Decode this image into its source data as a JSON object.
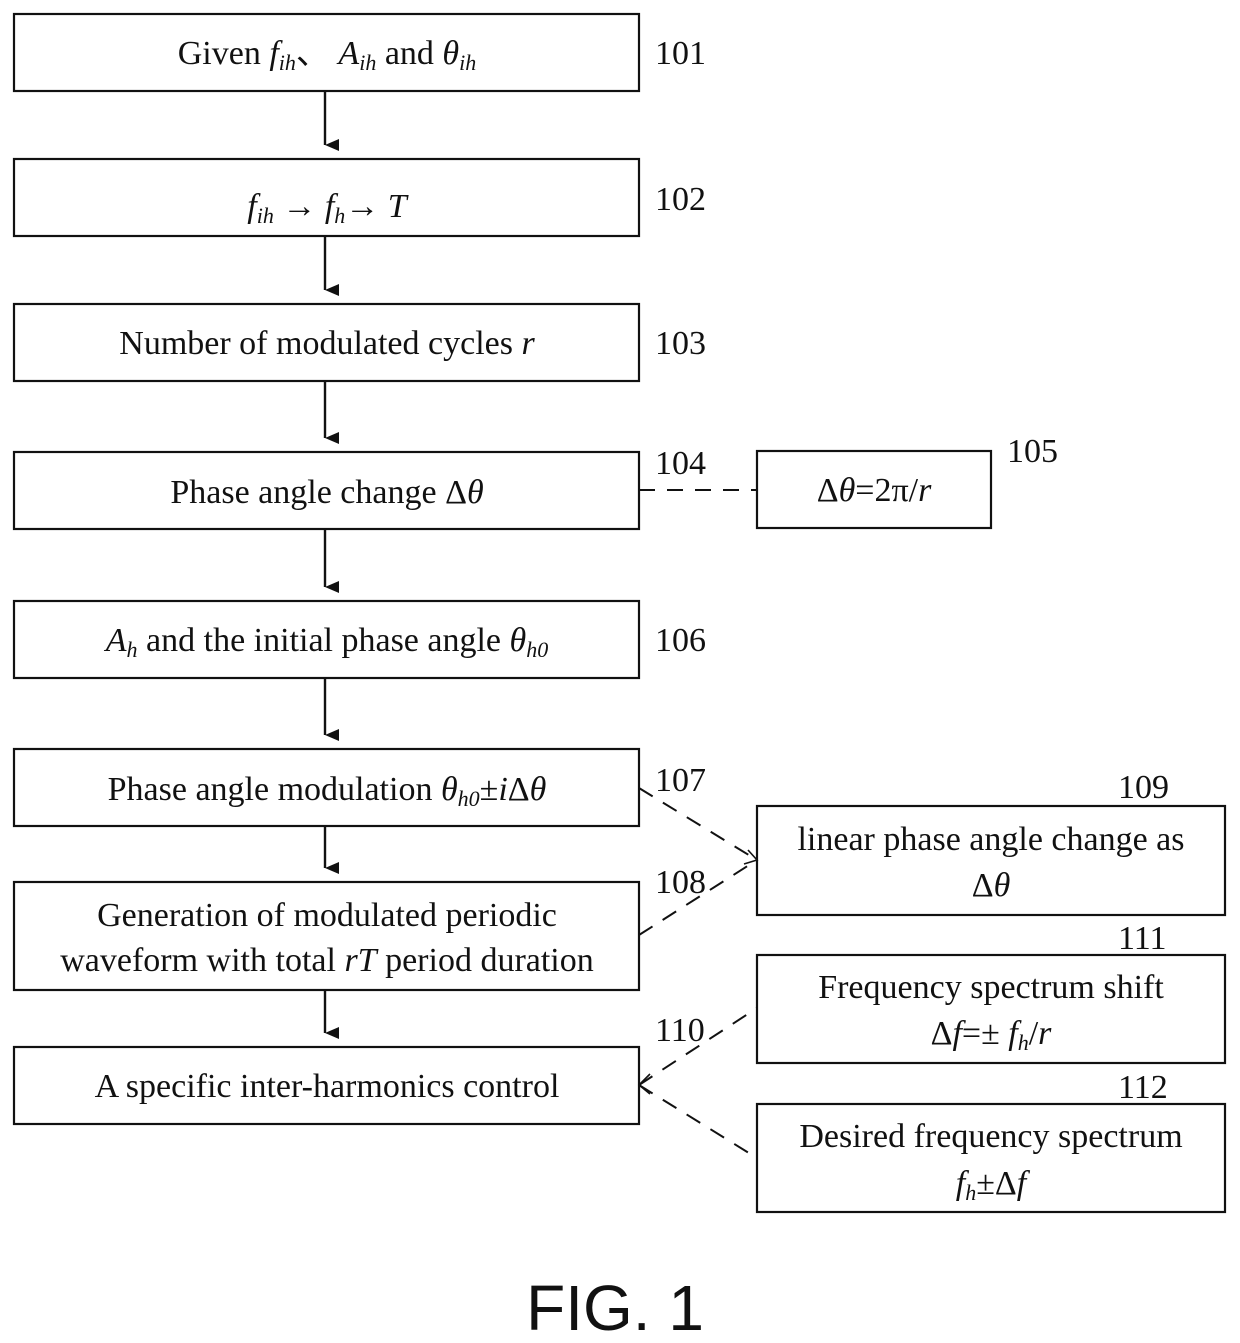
{
  "figure": {
    "caption": "FIG. 1"
  },
  "steps": {
    "s101": {
      "ref": "101",
      "parts": [
        "Given ",
        "f",
        "ih",
        "、 ",
        "A",
        "ih",
        " and ",
        "θ",
        "ih"
      ]
    },
    "s102": {
      "ref": "102",
      "parts": [
        "f",
        "ih",
        " → ",
        "f",
        "h",
        "→ ",
        "T"
      ]
    },
    "s103": {
      "ref": "103",
      "parts": [
        "Number of modulated cycles ",
        "r"
      ]
    },
    "s104": {
      "ref": "104",
      "parts": [
        "Phase angle change Δ",
        "θ"
      ]
    },
    "s105": {
      "ref": "105",
      "parts": [
        "Δ",
        "θ",
        "=2π/",
        "r"
      ]
    },
    "s106": {
      "ref": "106",
      "parts": [
        "A",
        "h",
        " and the initial phase angle ",
        "θ",
        "h0"
      ]
    },
    "s107": {
      "ref": "107",
      "parts": [
        "Phase angle modulation ",
        "θ",
        "h0",
        "±",
        "i",
        "Δ",
        "θ"
      ]
    },
    "s108": {
      "ref": "108",
      "line1": "Generation of modulated periodic",
      "line2_parts": [
        "waveform with total ",
        "rT",
        " period duration"
      ]
    },
    "s109": {
      "ref": "109",
      "line1": "linear phase angle change as",
      "line2_parts": [
        "Δ",
        "θ"
      ]
    },
    "s110": {
      "ref": "110",
      "parts": [
        "A specific inter-harmonics control"
      ]
    },
    "s111": {
      "ref": "111",
      "line1": "Frequency spectrum shift",
      "line2_parts": [
        "Δ",
        "f",
        "=± ",
        "f",
        "h",
        "/",
        "r"
      ]
    },
    "s112": {
      "ref": "112",
      "line1": "Desired frequency spectrum",
      "line2_parts": [
        "f",
        "h",
        "±Δ",
        "f"
      ]
    }
  },
  "connectors": {
    "solid_flow": [
      "101→102",
      "102→103",
      "103→104",
      "104→106",
      "106→107",
      "107→108",
      "108→110"
    ],
    "dashed_links": [
      "104–105",
      "107→109",
      "108→109",
      "110–111",
      "110–112"
    ]
  }
}
